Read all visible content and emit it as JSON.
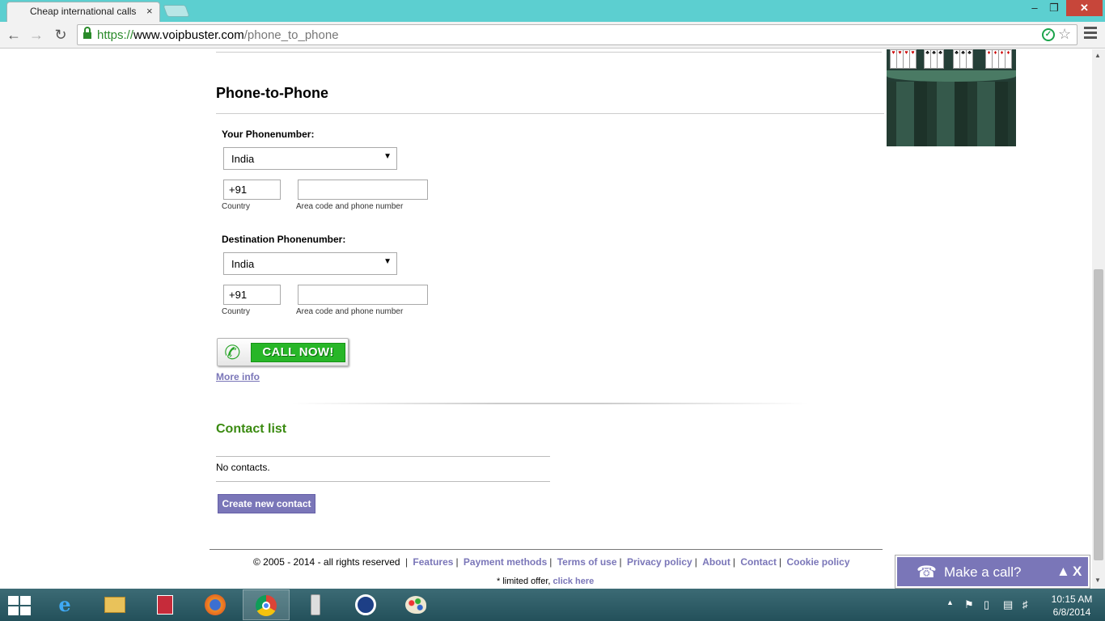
{
  "browser": {
    "tab_title": "Cheap international calls",
    "tab_close": "×",
    "url_scheme": "https://",
    "url_host": "www.voipbuster.com",
    "url_path": "/phone_to_phone",
    "window_min": "–",
    "window_max": "❐",
    "window_close": "✕"
  },
  "page": {
    "heading": "Phone-to-Phone",
    "your_phone": {
      "label": "Your Phonenumber:",
      "country_select": "India",
      "country_code": "+91",
      "phone_value": "",
      "country_caption": "Country",
      "phone_caption": "Area code and phone number"
    },
    "destination_phone": {
      "label": "Destination Phonenumber:",
      "country_select": "India",
      "country_code": "+91",
      "phone_value": "",
      "country_caption": "Country",
      "phone_caption": "Area code and phone number"
    },
    "call_button": "CALL NOW!",
    "more_info": "More info",
    "contacts": {
      "heading": "Contact list",
      "empty_text": "No contacts.",
      "create_button": "Create new contact"
    },
    "footer": {
      "copyright": "© 2005 - 2014 - all rights reserved",
      "links": [
        "Features",
        "Payment methods",
        "Terms of use",
        "Privacy policy",
        "About",
        "Contact",
        "Cookie policy"
      ],
      "offer_text": "* limited offer,",
      "offer_link": "click here"
    }
  },
  "call_widget": {
    "label": "Make a call?",
    "close": "X"
  },
  "taskbar": {
    "clock_time": "10:15 AM",
    "clock_date": "6/8/2014",
    "apps": [
      "internet-explorer",
      "file-explorer",
      "reader",
      "firefox",
      "chrome",
      "phone-app",
      "cyberlink",
      "paint"
    ]
  },
  "colors": {
    "link_purple": "#7a76b8",
    "contacts_green": "#3a8a10",
    "call_green": "#28b628",
    "titlebar": "#5ccfd0"
  }
}
